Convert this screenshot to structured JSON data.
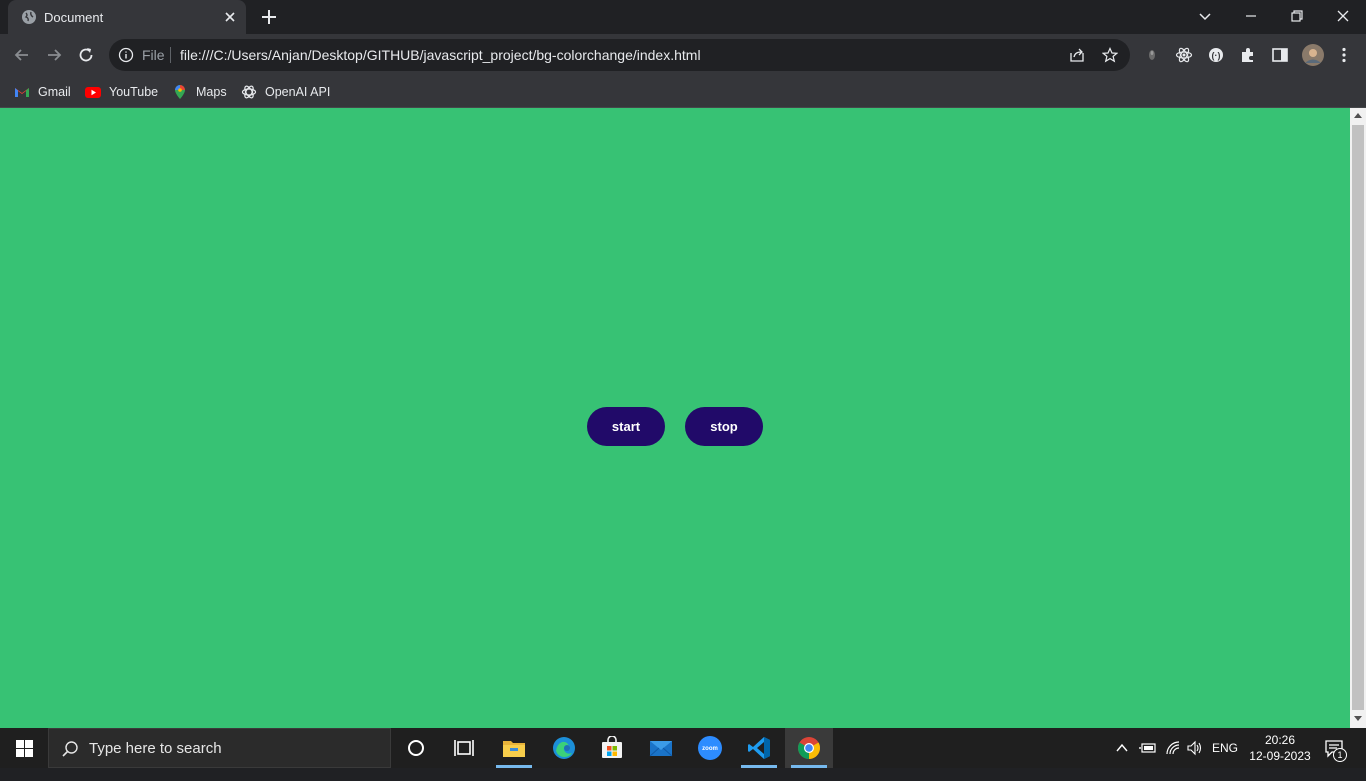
{
  "browser": {
    "tab": {
      "title": "Document",
      "favicon": "globe-icon"
    },
    "address_bar": {
      "scheme_label": "File",
      "url": "file:///C:/Users/Anjan/Desktop/GITHUB/javascript_project/bg-colorchange/index.html"
    },
    "bookmarks": [
      {
        "label": "Gmail",
        "icon": "gmail-icon"
      },
      {
        "label": "YouTube",
        "icon": "youtube-icon"
      },
      {
        "label": "Maps",
        "icon": "maps-icon"
      },
      {
        "label": "OpenAI API",
        "icon": "openai-icon"
      }
    ]
  },
  "page": {
    "background_color": "#37c274",
    "button_color": "#210a69",
    "start_label": "start",
    "stop_label": "stop"
  },
  "taskbar": {
    "search_placeholder": "Type here to search",
    "language": "ENG",
    "time": "20:26",
    "date": "12-09-2023",
    "notification_count": "1",
    "apps": [
      "cortana-icon",
      "task-view-icon",
      "file-explorer-icon",
      "edge-icon",
      "microsoft-store-icon",
      "mail-icon",
      "zoom-icon",
      "vscode-icon",
      "chrome-icon"
    ]
  }
}
